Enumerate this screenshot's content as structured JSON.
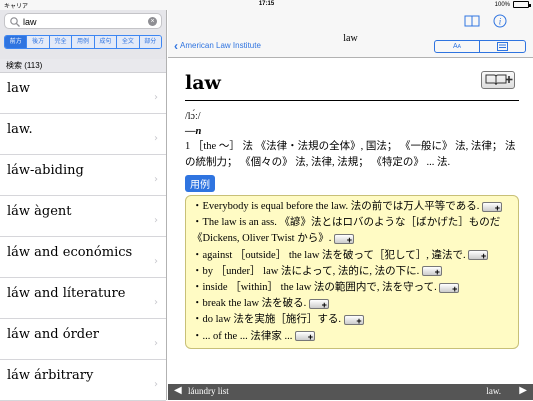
{
  "status": {
    "carrier": "キャリア",
    "time": "17:15",
    "battery": "100%",
    "battery_level": 1.0
  },
  "search": {
    "query": "law",
    "placeholder": ""
  },
  "modes": [
    "前方",
    "後方",
    "完全",
    "用例",
    "成句",
    "全文",
    "部分"
  ],
  "results": {
    "count_label": "検索 (113)",
    "items": [
      "law",
      "law.",
      "láw-abiding",
      "láw àgent",
      "láw and económics",
      "láw and líterature",
      "láw and órder",
      "láw árbitrary"
    ]
  },
  "nav": {
    "back_label": "American Law Institute",
    "title": "law",
    "seg_font": "A",
    "seg_font_sub": "A"
  },
  "entry": {
    "headword": "law",
    "pron": "/lɔ́ː/",
    "pos_dash": "—",
    "pos": "n",
    "def": "1 ［the ～］ 法 《法律・法規の全体》, 国法； 《一般に》 法, 法律； 法の統制力； 《個々の》 法, 法律, 法規； 《特定の》 ... 法.",
    "examples_label": "用例",
    "examples": [
      "・Everybody is equal before the law. 法の前では万人平等である.",
      "・The law is an ass. 《諺》法とはロバのような［ばかげた］ものだ 《Dickens, Oliver Twist から》.",
      "・against ［outside］ the law 法を破って［犯して］, 違法で.",
      "・by ［under］ law 法によって, 法的に, 法の下に.",
      "・inside ［within］ the law 法の範囲内で, 法を守って.",
      "・break the law 法を破る.",
      "・do law 法を実施［施行］する.",
      "・... of the ... 法律家 ..."
    ]
  },
  "bottom": {
    "prev": "láundry list",
    "next": "law."
  }
}
